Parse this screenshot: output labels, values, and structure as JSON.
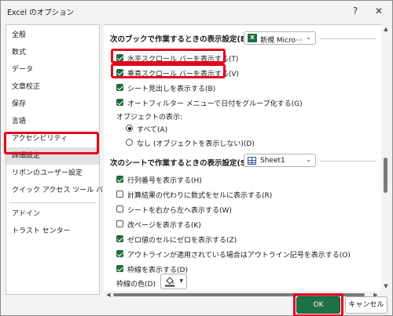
{
  "window": {
    "title": "Excel のオプション",
    "help_glyph": "?",
    "close_glyph": "✕"
  },
  "sidebar": {
    "items": [
      {
        "label": "全般"
      },
      {
        "label": "数式"
      },
      {
        "label": "データ"
      },
      {
        "label": "文章校正"
      },
      {
        "label": "保存"
      },
      {
        "label": "言語"
      },
      {
        "label": "アクセシビリティ"
      },
      {
        "label": "詳細設定"
      },
      {
        "label": "リボンのユーザー設定"
      },
      {
        "label": "クイック アクセス ツール バー"
      },
      {
        "label": "アドイン"
      },
      {
        "label": "トラスト センター"
      }
    ],
    "selected_index": 7
  },
  "book_section": {
    "heading": "次のブックで作業するときの表示設定(B):",
    "dropdown_value": "新規 Micro···",
    "options": [
      {
        "label": "水平スクロール バーを表示する(T)",
        "checked": true
      },
      {
        "label": "垂直スクロール バーを表示する(V)",
        "checked": true
      },
      {
        "label": "シート見出しを表示する(B)",
        "checked": true
      },
      {
        "label": "オートフィルター メニューで日付をグループ化する(G)",
        "checked": true
      }
    ],
    "objects_label": "オブジェクトの表示:",
    "radios": [
      {
        "label": "すべて(A)",
        "selected": true
      },
      {
        "label": "なし (オブジェクトを表示しない)(D)",
        "selected": false
      }
    ]
  },
  "sheet_section": {
    "heading": "次のシートで作業するときの表示設定(S):",
    "dropdown_value": "Sheet1",
    "options": [
      {
        "label": "行列番号を表示する(H)",
        "checked": true
      },
      {
        "label": "計算結果の代わりに数式をセルに表示する(R)",
        "checked": false
      },
      {
        "label": "シートを右から左へ表示する(W)",
        "checked": false
      },
      {
        "label": "改ページを表示する(K)",
        "checked": false
      },
      {
        "label": "ゼロ値のセルにゼロを表示する(Z)",
        "checked": true
      },
      {
        "label": "アウトラインが適用されている場合はアウトライン記号を表示する(O)",
        "checked": true
      },
      {
        "label": "枠線を表示する(D)",
        "checked": true
      }
    ],
    "gridline_color_label": "枠線の色(D)"
  },
  "footer": {
    "ok_label": "OK",
    "cancel_label": "キャンセル"
  },
  "colors": {
    "accent": "#1e7145",
    "highlight": "#e6001f"
  },
  "icons": [
    "excel-icon",
    "sheet-icon",
    "paint-bucket-icon",
    "chevron-down-icon",
    "help-icon",
    "close-icon"
  ]
}
